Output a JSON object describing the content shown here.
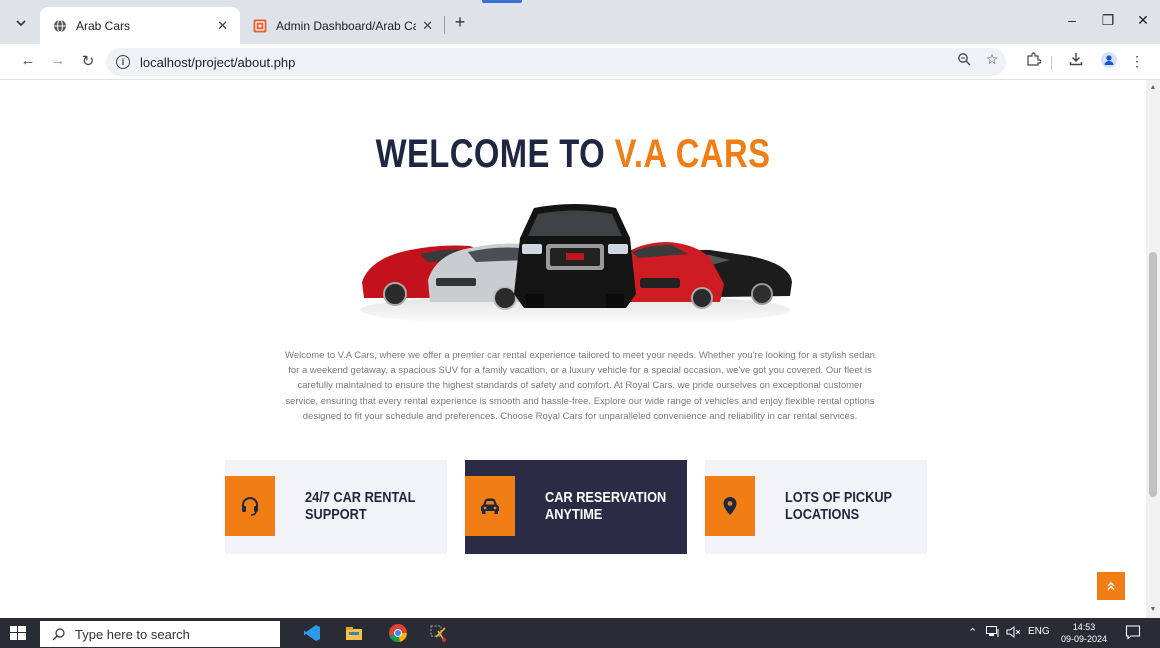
{
  "browser": {
    "tabs": [
      {
        "title": "Arab Cars",
        "active": true
      },
      {
        "title": "Admin Dashboard/Arab Cars",
        "active": false
      }
    ],
    "new_tab": "+",
    "url": "localhost/project/about.php",
    "window_controls": {
      "minimize": "–",
      "restore": "❐",
      "close": "✕"
    }
  },
  "page": {
    "heading_part1": "WELCOME TO ",
    "heading_accent": "V.A CARS",
    "intro": "Welcome to V.A Cars, where we offer a premier car rental experience tailored to meet your needs. Whether you're looking for a stylish sedan for a weekend getaway, a spacious SUV for a family vacation, or a luxury vehicle for a special occasion, we've got you covered. Our fleet is carefully maintained to ensure the highest standards of safety and comfort. At Royal Cars, we pride ourselves on exceptional customer service, ensuring that every rental experience is smooth and hassle-free. Explore our wide range of vehicles and enjoy flexible rental options designed to fit your schedule and preferences. Choose Royal Cars for unparalleled convenience and reliability in car rental services.",
    "features": [
      {
        "label": "24/7 CAR RENTAL SUPPORT",
        "icon": "headset-icon"
      },
      {
        "label": "CAR RESERVATION ANYTIME",
        "icon": "car-icon"
      },
      {
        "label": "LOTS OF PICKUP LOCATIONS",
        "icon": "map-marker-icon"
      }
    ],
    "accent_color": "#f07e14",
    "dark_color": "#1f2641"
  },
  "taskbar": {
    "search_placeholder": "Type here to search",
    "language": "ENG",
    "time": "14:53",
    "date": "09-09-2024"
  }
}
